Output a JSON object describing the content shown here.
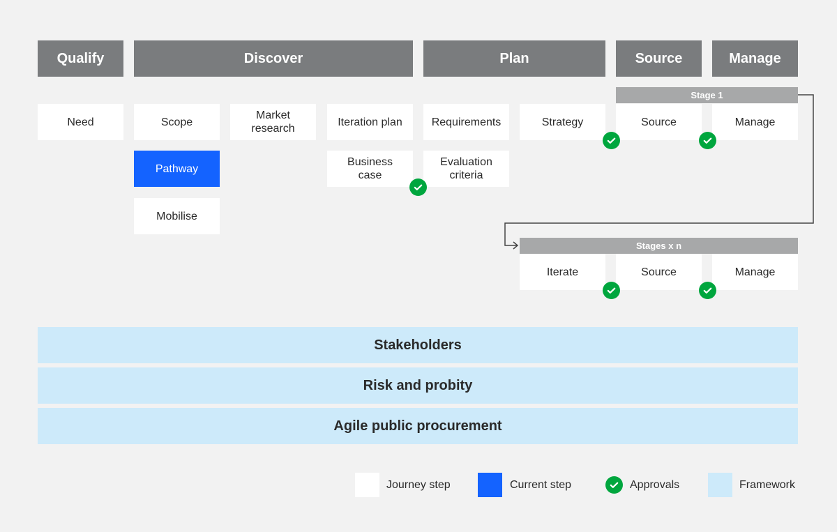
{
  "phases": [
    "Qualify",
    "Discover",
    "Plan",
    "Source",
    "Manage"
  ],
  "steps": {
    "need": "Need",
    "scope": "Scope",
    "market_research": "Market research",
    "iteration_plan": "Iteration plan",
    "requirements": "Requirements",
    "strategy": "Strategy",
    "source": "Source",
    "manage": "Manage",
    "pathway": "Pathway",
    "business_case": "Business case",
    "evaluation_criteria": "Evaluation criteria",
    "mobilise": "Mobilise",
    "iterate": "Iterate",
    "source_n": "Source",
    "manage_n": "Manage"
  },
  "stage1_label": "Stage 1",
  "stages_n_label": "Stages x n",
  "frameworks": [
    "Stakeholders",
    "Risk and probity",
    "Agile public procurement"
  ],
  "legend": {
    "journey_step": "Journey step",
    "current_step": "Current step",
    "approvals": "Approvals",
    "framework": "Framework"
  },
  "colors": {
    "phase": "#7a7c7e",
    "stage_bar": "#a7a8a9",
    "current": "#1463ff",
    "approval": "#00a63e",
    "framework": "#cdeafa",
    "background": "#f2f2f2"
  }
}
